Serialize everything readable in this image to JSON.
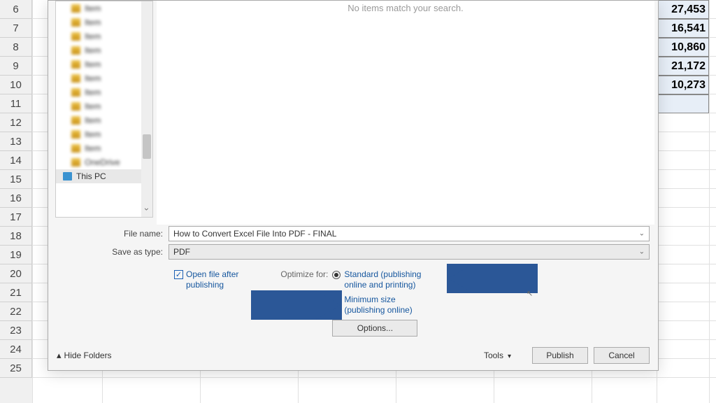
{
  "excel": {
    "row_start": 6,
    "row_end": 25,
    "data_cells": [
      {
        "row": 6,
        "value": "27,453"
      },
      {
        "row": 7,
        "value": "16,541"
      },
      {
        "row": 8,
        "value": "10,860"
      },
      {
        "row": 9,
        "value": "21,172"
      },
      {
        "row": 10,
        "value": "10,273"
      }
    ]
  },
  "nav": {
    "blurred_items": [
      "Item",
      "Item",
      "Item",
      "Item",
      "Item",
      "Item",
      "Item",
      "Item",
      "Item",
      "Item",
      "Item",
      "OneDrive"
    ],
    "this_pc": "This PC"
  },
  "file_area": {
    "empty_message": "No items match your search."
  },
  "form": {
    "file_name_label": "File name:",
    "file_name_value": "How to Convert Excel File Into PDF - FINAL",
    "save_type_label": "Save as type:",
    "save_type_value": "PDF"
  },
  "options": {
    "open_after_label": "Open file after\npublishing",
    "optimize_label": "Optimize for:",
    "standard_label": "Standard (publishing\nonline and printing)",
    "minimum_label": "Minimum size\n(publishing online)",
    "options_button": "Options..."
  },
  "footer": {
    "hide_folders": "Hide Folders",
    "tools": "Tools",
    "publish": "Publish",
    "cancel": "Cancel"
  }
}
